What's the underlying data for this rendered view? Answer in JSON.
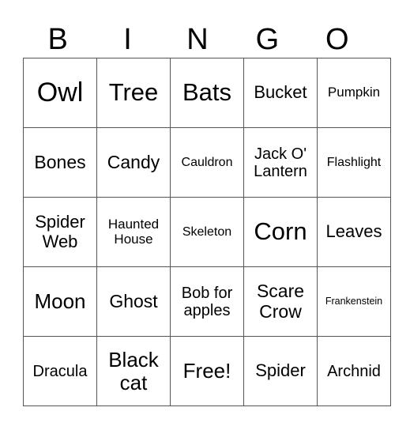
{
  "header": [
    "B",
    "I",
    "N",
    "G",
    "O"
  ],
  "grid": [
    [
      {
        "text": "Owl",
        "size": "s36"
      },
      {
        "text": "Tree",
        "size": "s32"
      },
      {
        "text": "Bats",
        "size": "s32"
      },
      {
        "text": "Bucket",
        "size": "s22"
      },
      {
        "text": "Pumpkin",
        "size": "s18"
      }
    ],
    [
      {
        "text": "Bones",
        "size": "s24"
      },
      {
        "text": "Candy",
        "size": "s24"
      },
      {
        "text": "Cauldron",
        "size": "s16"
      },
      {
        "text": "Jack O' Lantern",
        "size": "s20"
      },
      {
        "text": "Flashlight",
        "size": "s16"
      }
    ],
    [
      {
        "text": "Spider Web",
        "size": "s22"
      },
      {
        "text": "Haunted House",
        "size": "s18"
      },
      {
        "text": "Skeleton",
        "size": "s16"
      },
      {
        "text": "Corn",
        "size": "s32"
      },
      {
        "text": "Leaves",
        "size": "s22"
      }
    ],
    [
      {
        "text": "Moon",
        "size": "s28"
      },
      {
        "text": "Ghost",
        "size": "s24"
      },
      {
        "text": "Bob for apples",
        "size": "s20"
      },
      {
        "text": "Scare Crow",
        "size": "s24"
      },
      {
        "text": "Frankenstein",
        "size": "s13"
      }
    ],
    [
      {
        "text": "Dracula",
        "size": "s20"
      },
      {
        "text": "Black cat",
        "size": "s28"
      },
      {
        "text": "Free!",
        "size": "s28"
      },
      {
        "text": "Spider",
        "size": "s22"
      },
      {
        "text": "Archnid",
        "size": "s20"
      }
    ]
  ]
}
